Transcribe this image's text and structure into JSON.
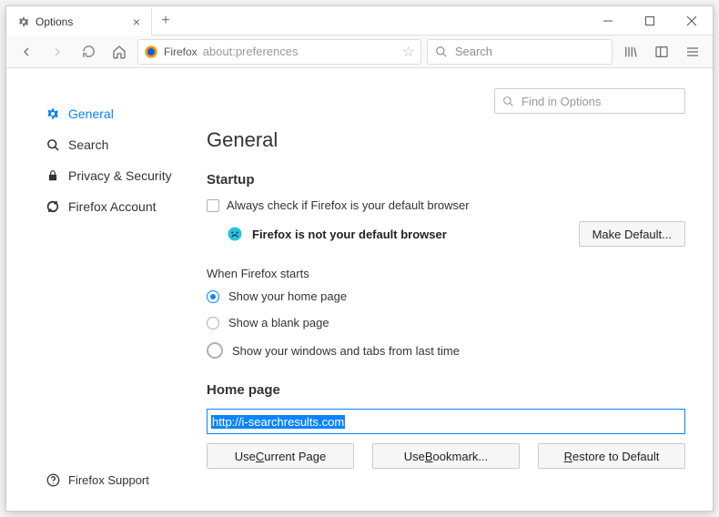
{
  "tab": {
    "title": "Options"
  },
  "urlbar": {
    "prefix": "Firefox",
    "url": "about:preferences"
  },
  "searchbar": {
    "placeholder": "Search"
  },
  "sidebar": {
    "items": [
      {
        "label": "General"
      },
      {
        "label": "Search"
      },
      {
        "label": "Privacy & Security"
      },
      {
        "label": "Firefox Account"
      }
    ],
    "support": "Firefox Support"
  },
  "find": {
    "placeholder": "Find in Options"
  },
  "page": {
    "title": "General"
  },
  "startup": {
    "title": "Startup",
    "always_check": "Always check if Firefox is your default browser",
    "not_default": "Firefox is not your default browser",
    "make_default": "Make Default...",
    "when_starts": "When Firefox starts",
    "opts": [
      "Show your home page",
      "Show a blank page",
      "Show your windows and tabs from last time"
    ]
  },
  "homepage": {
    "title": "Home page",
    "value": "http://i-searchresults.com",
    "use_current_pre": "Use ",
    "use_current_u": "C",
    "use_current_post": "urrent Page",
    "use_bookmark_pre": "Use ",
    "use_bookmark_u": "B",
    "use_bookmark_post": "ookmark...",
    "restore_u": "R",
    "restore_post": "estore to Default"
  }
}
